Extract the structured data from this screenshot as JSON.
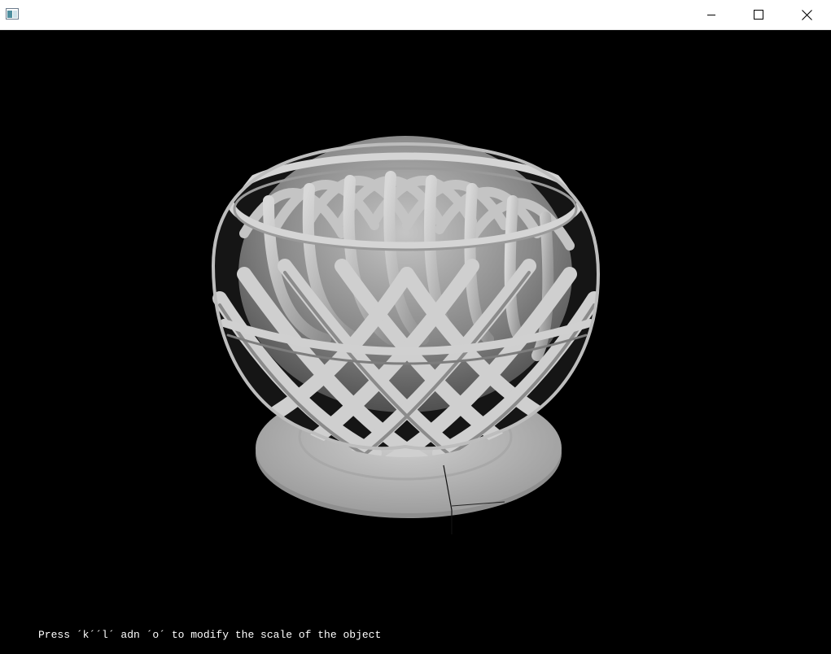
{
  "window": {
    "title": "",
    "icon": "app-window-icon",
    "controls": {
      "minimize_icon": "minimize-icon",
      "maximize_icon": "maximize-icon",
      "close_icon": "close-icon"
    }
  },
  "viewport": {
    "background_color": "#000000",
    "object_color": "#bdbdbd",
    "hint": "Press ´k´´l´ adn ´o´ to modify the scale of the object"
  }
}
